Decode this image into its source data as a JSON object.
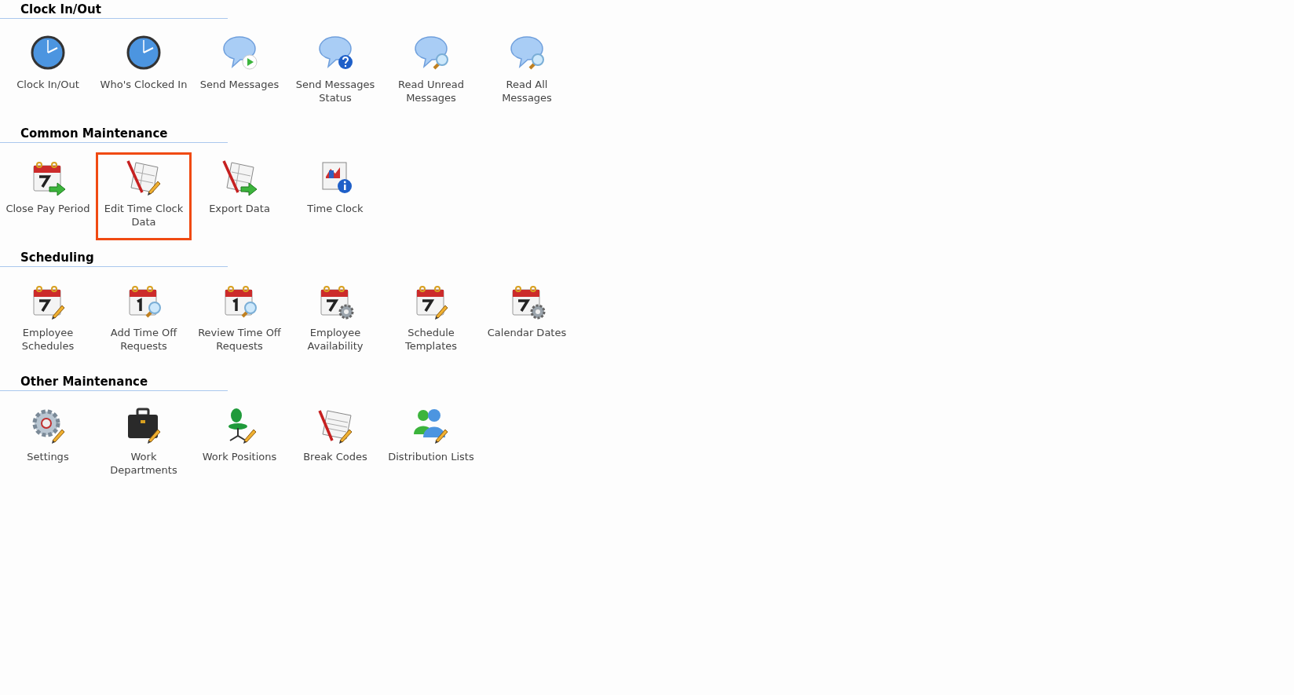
{
  "sections": [
    {
      "title": "Clock In/Out",
      "items": [
        {
          "label": "Clock In/Out",
          "kind": "clock",
          "selected": false
        },
        {
          "label": "Who's Clocked In",
          "kind": "clock",
          "selected": false
        },
        {
          "label": "Send Messages",
          "kind": "chat-play",
          "selected": false
        },
        {
          "label": "Send Messages Status",
          "kind": "chat-question",
          "selected": false
        },
        {
          "label": "Read Unread Messages",
          "kind": "chat-search",
          "selected": false
        },
        {
          "label": "Read All Messages",
          "kind": "chat-search",
          "selected": false
        }
      ]
    },
    {
      "title": "Common Maintenance",
      "items": [
        {
          "label": "Close Pay Period",
          "kind": "calendar-arrow",
          "selected": false
        },
        {
          "label": "Edit Time Clock Data",
          "kind": "sheet-pencil",
          "selected": true
        },
        {
          "label": "Export Data",
          "kind": "sheet-arrow",
          "selected": false
        },
        {
          "label": "Time Clock",
          "kind": "calendar-info",
          "selected": false
        }
      ]
    },
    {
      "title": "Scheduling",
      "items": [
        {
          "label": "Employee Schedules",
          "kind": "calendar-pencil",
          "selected": false
        },
        {
          "label": "Add Time Off Requests",
          "kind": "calendar-search",
          "selected": false
        },
        {
          "label": "Review Time Off Requests",
          "kind": "calendar-search",
          "selected": false
        },
        {
          "label": "Employee Availability",
          "kind": "calendar-gear",
          "selected": false
        },
        {
          "label": "Schedule Templates",
          "kind": "calendar-pencil",
          "selected": false
        },
        {
          "label": "Calendar Dates",
          "kind": "calendar-gear",
          "selected": false
        }
      ]
    },
    {
      "title": "Other Maintenance",
      "items": [
        {
          "label": "Settings",
          "kind": "gear-pencil",
          "selected": false
        },
        {
          "label": "Work Departments",
          "kind": "briefcase",
          "selected": false
        },
        {
          "label": "Work Positions",
          "kind": "chair",
          "selected": false
        },
        {
          "label": "Break Codes",
          "kind": "notepad-pencil",
          "selected": false
        },
        {
          "label": "Distribution Lists",
          "kind": "people",
          "selected": false
        }
      ]
    }
  ]
}
